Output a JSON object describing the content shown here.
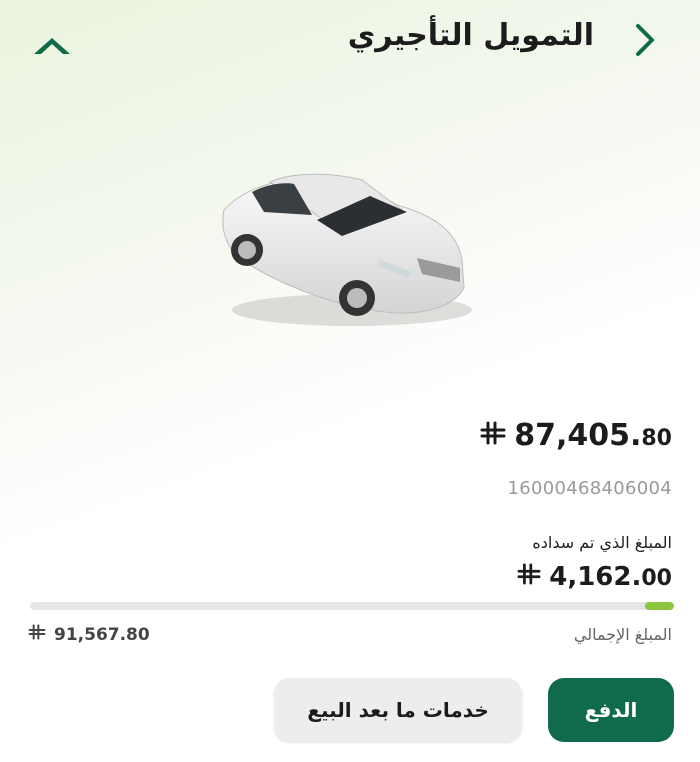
{
  "header": {
    "title": "التمويل التأجيري",
    "back_icon": "chevron-right-icon",
    "logo_icon": "chevron-up-logo-icon",
    "accent_color": "#0f6b4a"
  },
  "vehicle": {
    "image": "white-sedan-car"
  },
  "lease": {
    "remaining_amount_int": "87,405.",
    "remaining_amount_dec": "80",
    "contract_number": "16000468406004",
    "paid_label": "المبلغ الذي تم سداده",
    "paid_amount_int": "4,162.",
    "paid_amount_dec": "00",
    "progress_fraction": 0.045,
    "progress_color": "#8cc63f",
    "total_label": "المبلغ الإجمالي",
    "total_amount": "91,567.80",
    "currency_icon": "saudi-riyal-icon"
  },
  "actions": {
    "pay_label": "الدفع",
    "after_sale_label": "خدمات ما بعد البيع"
  }
}
